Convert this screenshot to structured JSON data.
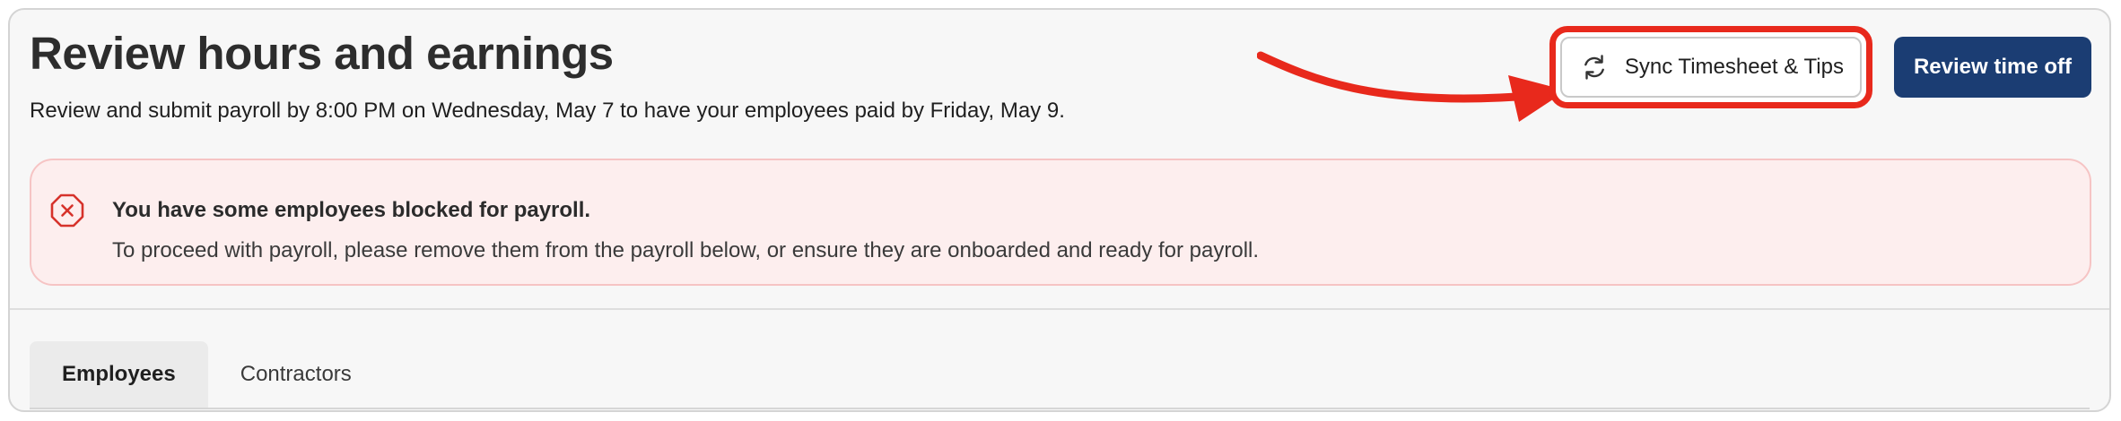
{
  "header": {
    "title": "Review hours and earnings",
    "subtitle": "Review and submit payroll by 8:00 PM on Wednesday, May 7 to have your employees paid by Friday, May 9.",
    "sync_button_label": "Sync Timesheet & Tips",
    "review_time_off_label": "Review time off"
  },
  "alert": {
    "title": "You have some employees blocked for payroll.",
    "body": "To proceed with payroll, please remove them from the payroll below, or ensure they are onboarded and ready for payroll."
  },
  "tabs": [
    {
      "label": "Employees",
      "active": true
    },
    {
      "label": "Contractors",
      "active": false
    }
  ],
  "colors": {
    "primary": "#1b3d73",
    "alert_background": "#fdeeee",
    "alert_icon": "#d6322b",
    "highlight": "#e8291c"
  },
  "icons": {
    "sync": "sync-icon",
    "alert": "error-octagon-icon",
    "annotation": "arrow-annotation-icon"
  }
}
